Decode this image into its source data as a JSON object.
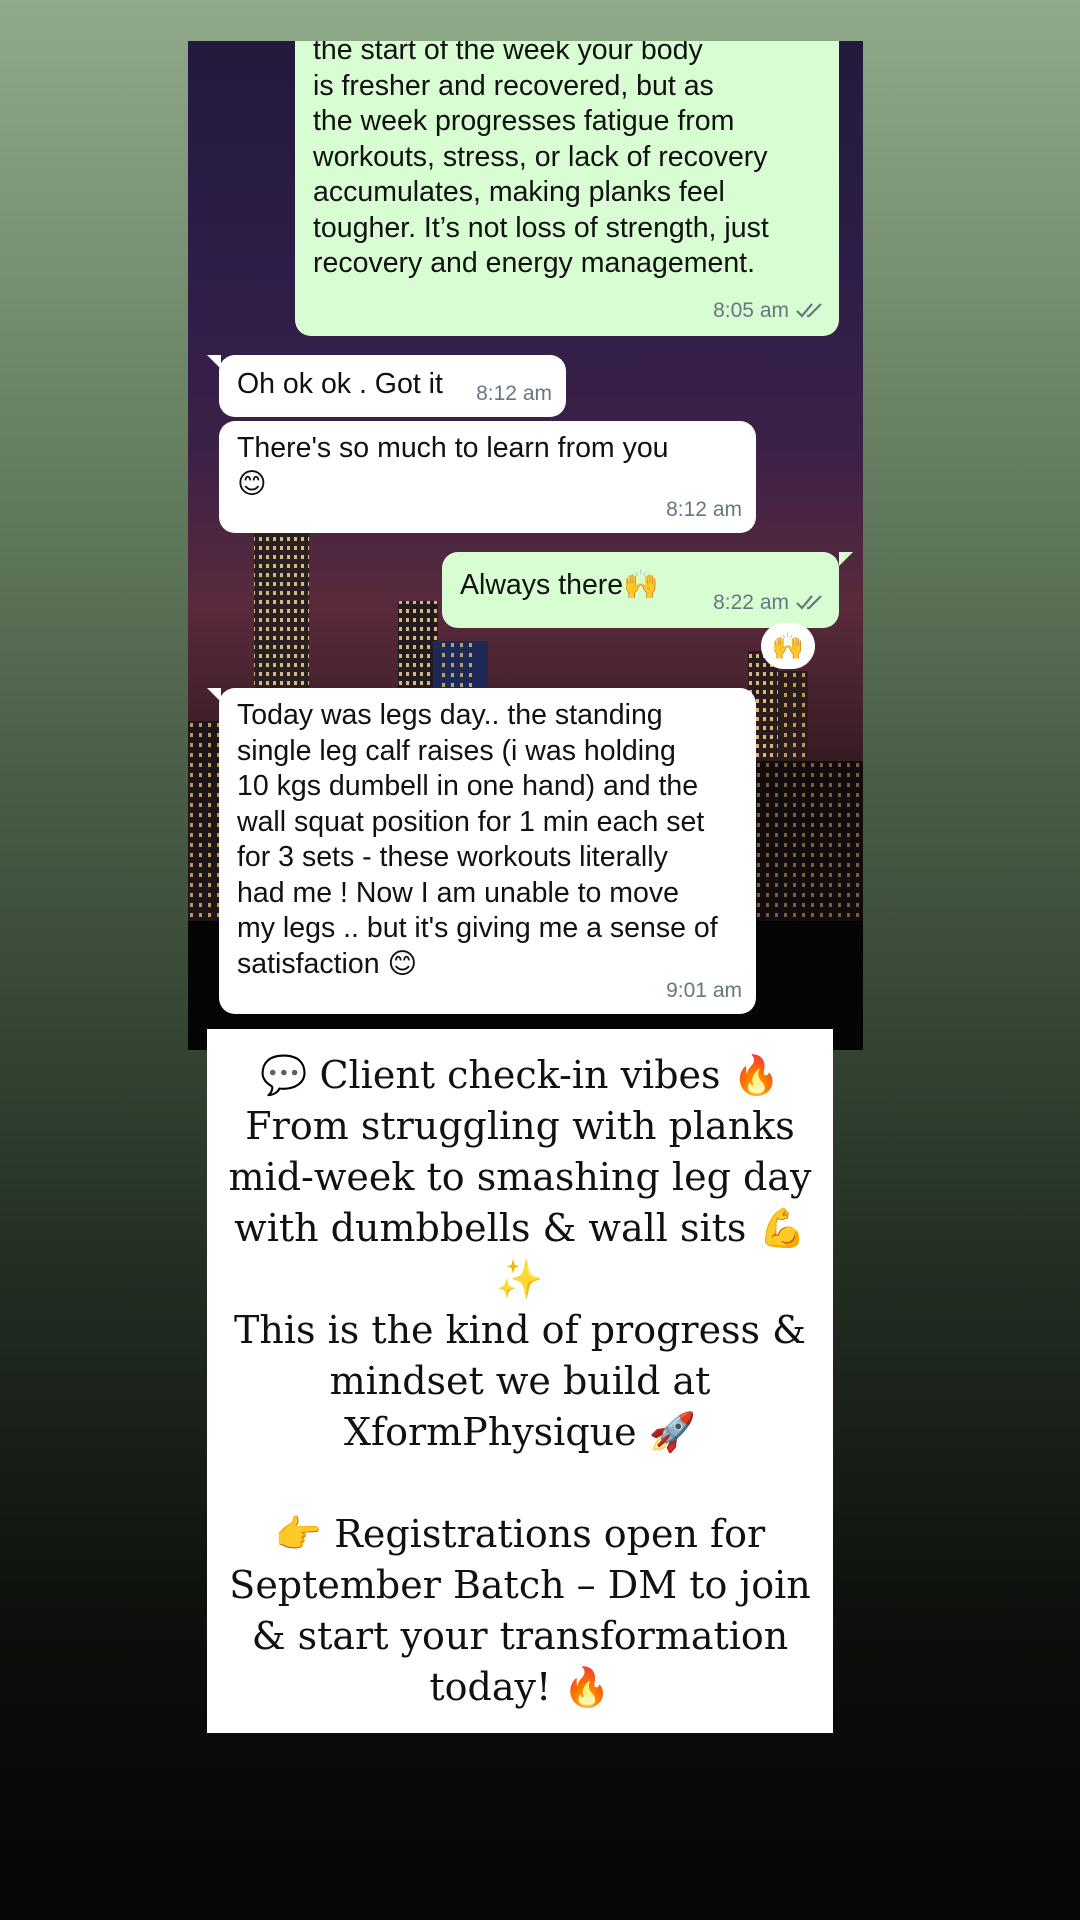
{
  "chat": {
    "messages": [
      {
        "direction": "outgoing",
        "text": "the start of the week your body\nis fresher and recovered, but as\nthe week progresses fatigue from\nworkouts, stress, or lack of recovery\naccumulates, making planks feel\ntougher. It’s not loss of strength, just\nrecovery and energy management.",
        "time": "8:05 am",
        "status": "read"
      },
      {
        "direction": "incoming",
        "text": "Oh ok ok . Got it",
        "time": "8:12 am"
      },
      {
        "direction": "incoming",
        "text": "There's so much to learn from you\n😊",
        "time": "8:12 am"
      },
      {
        "direction": "outgoing",
        "text": "Always there🙌",
        "time": "8:22 am",
        "status": "read",
        "reaction": "🙌"
      },
      {
        "direction": "incoming",
        "text": "Today was legs day.. the standing\nsingle leg calf raises (i was holding\n10 kgs dumbell in one hand) and the\nwall squat position for 1 min each set\nfor 3 sets - these workouts literally\nhad me ! Now I am unable to move\nmy legs .. but it's giving me a sense of\nsatisfaction 😊",
        "time": "9:01 am"
      }
    ],
    "colors": {
      "outgoing": "#d9fdd3",
      "incoming": "#ffffff",
      "time": "#667781",
      "read_ticks": "#667781"
    }
  },
  "caption": {
    "lines": [
      "💬 Client check-in vibes 🔥",
      "From struggling with planks",
      "mid-week to smashing leg day",
      "with dumbbells & wall sits 💪",
      "✨",
      "This is the kind of progress &",
      "mindset we build at",
      "XformPhysique 🚀",
      "",
      "👉 Registrations open for",
      "September Batch – DM to join",
      "& start your transformation",
      "today! 🔥"
    ]
  }
}
